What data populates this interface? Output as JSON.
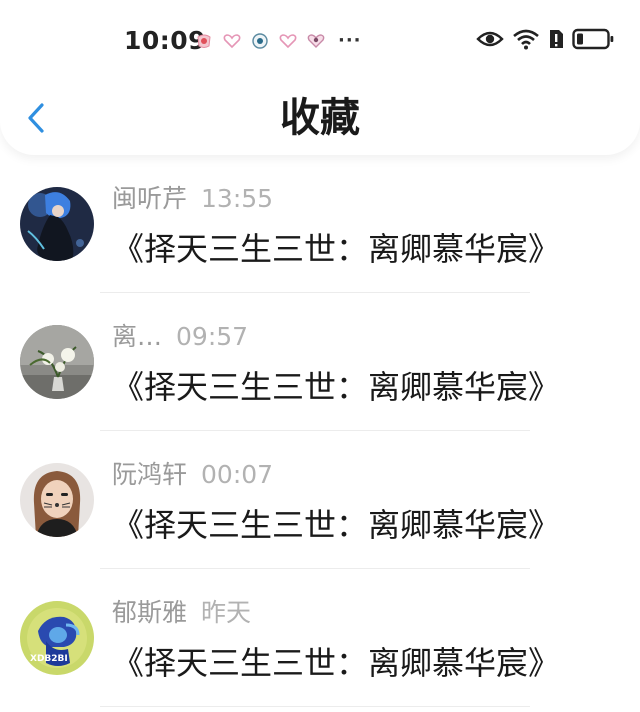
{
  "status_bar": {
    "time": "10:09",
    "more": "···"
  },
  "header": {
    "title": "收藏"
  },
  "items": [
    {
      "sender": "闽听芹",
      "time": "13:55",
      "content": "《择天三生三世：离卿慕华宸》"
    },
    {
      "sender": "离…",
      "time": "09:57",
      "content": "《择天三生三世：离卿慕华宸》"
    },
    {
      "sender": "阮鸿轩",
      "time": "00:07",
      "content": "《择天三生三世：离卿慕华宸》"
    },
    {
      "sender": "郁斯雅",
      "time": "昨天",
      "content": "《择天三生三世：离卿慕华宸》",
      "avatar_text": "XDB2BI"
    }
  ],
  "colors": {
    "accent": "#2f8fe0",
    "title": "#1a1a1a",
    "sender": "#9a9a9a",
    "time": "#b2b2b2"
  }
}
